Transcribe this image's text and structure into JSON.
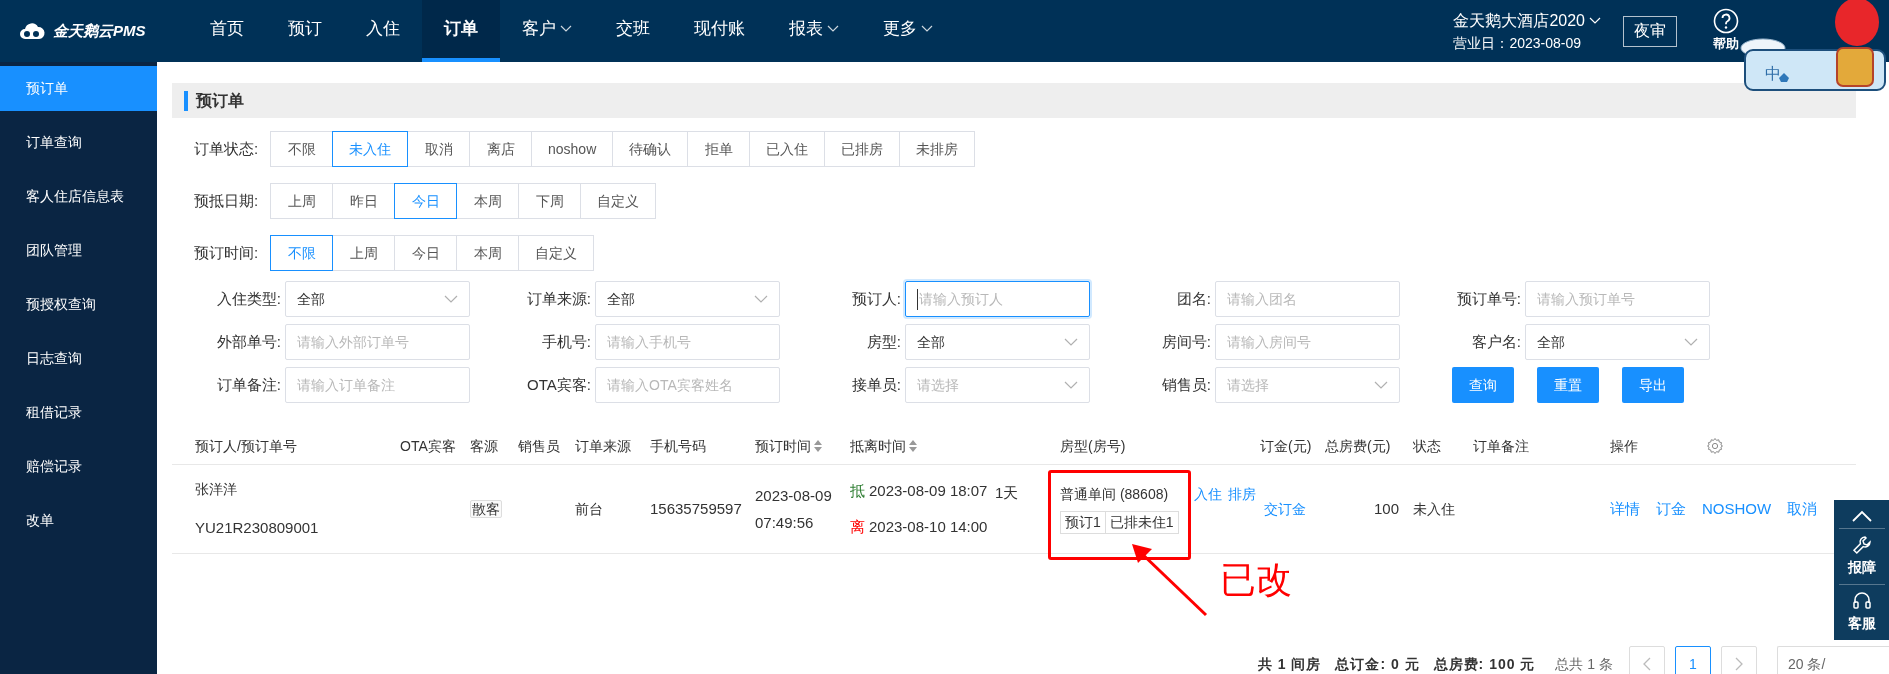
{
  "brand": {
    "name": "金天鹅云PMS"
  },
  "nav": [
    {
      "label": "首页",
      "selected": false,
      "dropdown": false
    },
    {
      "label": "预订",
      "selected": false,
      "dropdown": false
    },
    {
      "label": "入住",
      "selected": false,
      "dropdown": false
    },
    {
      "label": "订单",
      "selected": true,
      "dropdown": false
    },
    {
      "label": "客户",
      "selected": false,
      "dropdown": true
    },
    {
      "label": "交班",
      "selected": false,
      "dropdown": false
    },
    {
      "label": "现付账",
      "selected": false,
      "dropdown": false
    },
    {
      "label": "报表",
      "selected": false,
      "dropdown": true
    },
    {
      "label": "更多",
      "selected": false,
      "dropdown": true
    }
  ],
  "hotel": {
    "name": "金天鹅大酒店2020",
    "business_date": "营业日：2023-08-09"
  },
  "night_audit_button": "夜审",
  "help": "帮助",
  "ime_widget": {
    "label": "中"
  },
  "sidebar": [
    {
      "label": "预订单",
      "selected": true
    },
    {
      "label": "订单查询",
      "selected": false
    },
    {
      "label": "客人住店信息表",
      "selected": false
    },
    {
      "label": "团队管理",
      "selected": false
    },
    {
      "label": "预授权查询",
      "selected": false
    },
    {
      "label": "日志查询",
      "selected": false
    },
    {
      "label": "租借记录",
      "selected": false
    },
    {
      "label": "赔偿记录",
      "selected": false
    },
    {
      "label": "改单",
      "selected": false
    }
  ],
  "page_title": "预订单",
  "filter_groups": [
    {
      "label": "订单状态:",
      "options": [
        {
          "label": "不限",
          "selected": false
        },
        {
          "label": "未入住",
          "selected": true
        },
        {
          "label": "取消",
          "selected": false
        },
        {
          "label": "离店",
          "selected": false
        },
        {
          "label": "noshow",
          "selected": false
        },
        {
          "label": "待确认",
          "selected": false
        },
        {
          "label": "拒单",
          "selected": false
        },
        {
          "label": "已入住",
          "selected": false
        },
        {
          "label": "已排房",
          "selected": false
        },
        {
          "label": "未排房",
          "selected": false
        }
      ]
    },
    {
      "label": "预抵日期:",
      "options": [
        {
          "label": "上周",
          "selected": false
        },
        {
          "label": "昨日",
          "selected": false
        },
        {
          "label": "今日",
          "selected": true
        },
        {
          "label": "本周",
          "selected": false
        },
        {
          "label": "下周",
          "selected": false
        },
        {
          "label": "自定义",
          "selected": false
        }
      ]
    },
    {
      "label": "预订时间:",
      "options": [
        {
          "label": "不限",
          "selected": true
        },
        {
          "label": "上周",
          "selected": false
        },
        {
          "label": "今日",
          "selected": false
        },
        {
          "label": "本周",
          "selected": false
        },
        {
          "label": "自定义",
          "selected": false
        }
      ]
    }
  ],
  "form_rows": [
    [
      {
        "label": "入住类型:",
        "kind": "select",
        "value": "全部"
      },
      {
        "label": "订单来源:",
        "kind": "select",
        "value": "全部"
      },
      {
        "label": "预订人:",
        "kind": "input",
        "placeholder": "请输入预订人",
        "focused": true
      },
      {
        "label": "团名:",
        "kind": "input",
        "placeholder": "请输入团名"
      },
      {
        "label": "预订单号:",
        "kind": "input",
        "placeholder": "请输入预订单号"
      }
    ],
    [
      {
        "label": "外部单号:",
        "kind": "input",
        "placeholder": "请输入外部订单号"
      },
      {
        "label": "手机号:",
        "kind": "input",
        "placeholder": "请输入手机号"
      },
      {
        "label": "房型:",
        "kind": "select",
        "value": "全部"
      },
      {
        "label": "房间号:",
        "kind": "input",
        "placeholder": "请输入房间号"
      },
      {
        "label": "客户名:",
        "kind": "select",
        "value": "全部"
      }
    ],
    [
      {
        "label": "订单备注:",
        "kind": "input",
        "placeholder": "请输入订单备注"
      },
      {
        "label": "OTA宾客:",
        "kind": "input",
        "placeholder": "请输入OTA宾客姓名"
      },
      {
        "label": "接单员:",
        "kind": "select",
        "placeholder": "请选择"
      },
      {
        "label": "销售员:",
        "kind": "select",
        "placeholder": "请选择"
      }
    ]
  ],
  "form_buttons": [
    "查询",
    "重置",
    "导出"
  ],
  "table": {
    "columns": [
      {
        "label": "预订人/预订单号",
        "sortable": false
      },
      {
        "label": "OTA宾客",
        "sortable": false
      },
      {
        "label": "客源",
        "sortable": false
      },
      {
        "label": "销售员",
        "sortable": false
      },
      {
        "label": "订单来源",
        "sortable": false
      },
      {
        "label": "手机号码",
        "sortable": false
      },
      {
        "label": "预订时间",
        "sortable": true
      },
      {
        "label": "抵离时间",
        "sortable": true
      },
      {
        "label": "房型(房号)",
        "sortable": false
      },
      {
        "label": "订金(元)",
        "sortable": false
      },
      {
        "label": "总房费(元)",
        "sortable": false
      },
      {
        "label": "状态",
        "sortable": false
      },
      {
        "label": "订单备注",
        "sortable": false
      },
      {
        "label": "操作",
        "sortable": false
      }
    ],
    "rows": [
      {
        "booker": "张洋洋",
        "order_no": "YU21R230809001",
        "source": "散客",
        "channel": "前台",
        "phone": "15635759597",
        "booked_at": "2023-08-09 07:49:56",
        "stay": [
          {
            "kind": "arrive",
            "tag": "抵",
            "time": "2023-08-09 18:07"
          },
          {
            "kind": "depart",
            "tag": "离",
            "time": "2023-08-10 14:00"
          }
        ],
        "nights": "1天",
        "room": "普通单间 (88608)",
        "room_actions": [
          "入住",
          "排房"
        ],
        "room_tags": [
          "预订1",
          "已排未住1"
        ],
        "deposit": "交订金",
        "total": "100",
        "status": "未入住",
        "actions": [
          "详情",
          "订金",
          "NOSHOW",
          "取消"
        ]
      }
    ]
  },
  "annotation": {
    "text": "已改"
  },
  "pagination": {
    "summary": [
      "共 1 间房",
      "总订金: 0 元",
      "总房费: 100 元"
    ],
    "total": "总共 1 条",
    "pages": [
      {
        "label": "1",
        "selected": true
      }
    ],
    "page_size": "20 条/"
  },
  "side_toolbar": [
    {
      "kind": "top"
    },
    {
      "kind": "report",
      "label": "报障"
    },
    {
      "kind": "service",
      "label": "客服"
    }
  ]
}
